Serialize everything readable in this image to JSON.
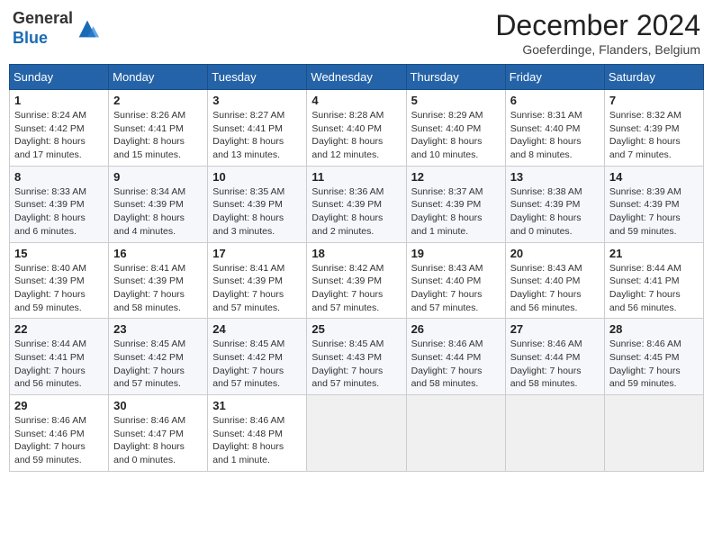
{
  "header": {
    "logo_general": "General",
    "logo_blue": "Blue",
    "month_year": "December 2024",
    "location": "Goeferdinge, Flanders, Belgium"
  },
  "days_of_week": [
    "Sunday",
    "Monday",
    "Tuesday",
    "Wednesday",
    "Thursday",
    "Friday",
    "Saturday"
  ],
  "weeks": [
    [
      {
        "day": "1",
        "sunrise": "8:24 AM",
        "sunset": "4:42 PM",
        "daylight": "8 hours and 17 minutes."
      },
      {
        "day": "2",
        "sunrise": "8:26 AM",
        "sunset": "4:41 PM",
        "daylight": "8 hours and 15 minutes."
      },
      {
        "day": "3",
        "sunrise": "8:27 AM",
        "sunset": "4:41 PM",
        "daylight": "8 hours and 13 minutes."
      },
      {
        "day": "4",
        "sunrise": "8:28 AM",
        "sunset": "4:40 PM",
        "daylight": "8 hours and 12 minutes."
      },
      {
        "day": "5",
        "sunrise": "8:29 AM",
        "sunset": "4:40 PM",
        "daylight": "8 hours and 10 minutes."
      },
      {
        "day": "6",
        "sunrise": "8:31 AM",
        "sunset": "4:40 PM",
        "daylight": "8 hours and 8 minutes."
      },
      {
        "day": "7",
        "sunrise": "8:32 AM",
        "sunset": "4:39 PM",
        "daylight": "8 hours and 7 minutes."
      }
    ],
    [
      {
        "day": "8",
        "sunrise": "8:33 AM",
        "sunset": "4:39 PM",
        "daylight": "8 hours and 6 minutes."
      },
      {
        "day": "9",
        "sunrise": "8:34 AM",
        "sunset": "4:39 PM",
        "daylight": "8 hours and 4 minutes."
      },
      {
        "day": "10",
        "sunrise": "8:35 AM",
        "sunset": "4:39 PM",
        "daylight": "8 hours and 3 minutes."
      },
      {
        "day": "11",
        "sunrise": "8:36 AM",
        "sunset": "4:39 PM",
        "daylight": "8 hours and 2 minutes."
      },
      {
        "day": "12",
        "sunrise": "8:37 AM",
        "sunset": "4:39 PM",
        "daylight": "8 hours and 1 minute."
      },
      {
        "day": "13",
        "sunrise": "8:38 AM",
        "sunset": "4:39 PM",
        "daylight": "8 hours and 0 minutes."
      },
      {
        "day": "14",
        "sunrise": "8:39 AM",
        "sunset": "4:39 PM",
        "daylight": "7 hours and 59 minutes."
      }
    ],
    [
      {
        "day": "15",
        "sunrise": "8:40 AM",
        "sunset": "4:39 PM",
        "daylight": "7 hours and 59 minutes."
      },
      {
        "day": "16",
        "sunrise": "8:41 AM",
        "sunset": "4:39 PM",
        "daylight": "7 hours and 58 minutes."
      },
      {
        "day": "17",
        "sunrise": "8:41 AM",
        "sunset": "4:39 PM",
        "daylight": "7 hours and 57 minutes."
      },
      {
        "day": "18",
        "sunrise": "8:42 AM",
        "sunset": "4:39 PM",
        "daylight": "7 hours and 57 minutes."
      },
      {
        "day": "19",
        "sunrise": "8:43 AM",
        "sunset": "4:40 PM",
        "daylight": "7 hours and 57 minutes."
      },
      {
        "day": "20",
        "sunrise": "8:43 AM",
        "sunset": "4:40 PM",
        "daylight": "7 hours and 56 minutes."
      },
      {
        "day": "21",
        "sunrise": "8:44 AM",
        "sunset": "4:41 PM",
        "daylight": "7 hours and 56 minutes."
      }
    ],
    [
      {
        "day": "22",
        "sunrise": "8:44 AM",
        "sunset": "4:41 PM",
        "daylight": "7 hours and 56 minutes."
      },
      {
        "day": "23",
        "sunrise": "8:45 AM",
        "sunset": "4:42 PM",
        "daylight": "7 hours and 57 minutes."
      },
      {
        "day": "24",
        "sunrise": "8:45 AM",
        "sunset": "4:42 PM",
        "daylight": "7 hours and 57 minutes."
      },
      {
        "day": "25",
        "sunrise": "8:45 AM",
        "sunset": "4:43 PM",
        "daylight": "7 hours and 57 minutes."
      },
      {
        "day": "26",
        "sunrise": "8:46 AM",
        "sunset": "4:44 PM",
        "daylight": "7 hours and 58 minutes."
      },
      {
        "day": "27",
        "sunrise": "8:46 AM",
        "sunset": "4:44 PM",
        "daylight": "7 hours and 58 minutes."
      },
      {
        "day": "28",
        "sunrise": "8:46 AM",
        "sunset": "4:45 PM",
        "daylight": "7 hours and 59 minutes."
      }
    ],
    [
      {
        "day": "29",
        "sunrise": "8:46 AM",
        "sunset": "4:46 PM",
        "daylight": "7 hours and 59 minutes."
      },
      {
        "day": "30",
        "sunrise": "8:46 AM",
        "sunset": "4:47 PM",
        "daylight": "8 hours and 0 minutes."
      },
      {
        "day": "31",
        "sunrise": "8:46 AM",
        "sunset": "4:48 PM",
        "daylight": "8 hours and 1 minute."
      },
      null,
      null,
      null,
      null
    ]
  ],
  "labels": {
    "sunrise": "Sunrise:",
    "sunset": "Sunset:",
    "daylight": "Daylight:"
  }
}
